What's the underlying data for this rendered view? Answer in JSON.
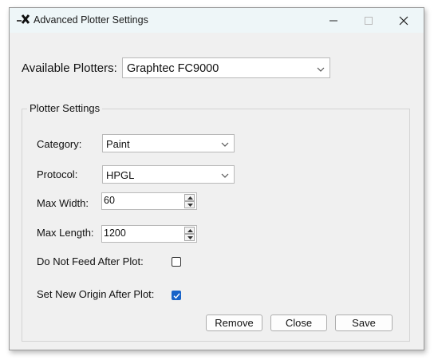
{
  "window": {
    "title": "Advanced Plotter Settings",
    "icon": "plotter-app-icon",
    "controls": {
      "minimize": "—",
      "maximize": "☐",
      "close": "✕"
    }
  },
  "available_plotters": {
    "label": "Available Plotters:",
    "value": "Graphtec FC9000"
  },
  "plotter_settings": {
    "group_label": "Plotter Settings",
    "category": {
      "label": "Category:",
      "value": "Paint"
    },
    "protocol": {
      "label": "Protocol:",
      "value": "HPGL"
    },
    "max_width": {
      "label": "Max Width:",
      "value": "60"
    },
    "max_length": {
      "label": "Max Length:",
      "value": "1200"
    },
    "do_not_feed": {
      "label": "Do Not Feed After Plot:",
      "checked": false
    },
    "set_new_origin": {
      "label": "Set New Origin After Plot:",
      "checked": true
    }
  },
  "buttons": {
    "remove": "Remove",
    "close": "Close",
    "save": "Save"
  },
  "colors": {
    "titlebar": "#eef6f8",
    "window_bg": "#f0f0f0",
    "check_accent": "#1863c8"
  }
}
